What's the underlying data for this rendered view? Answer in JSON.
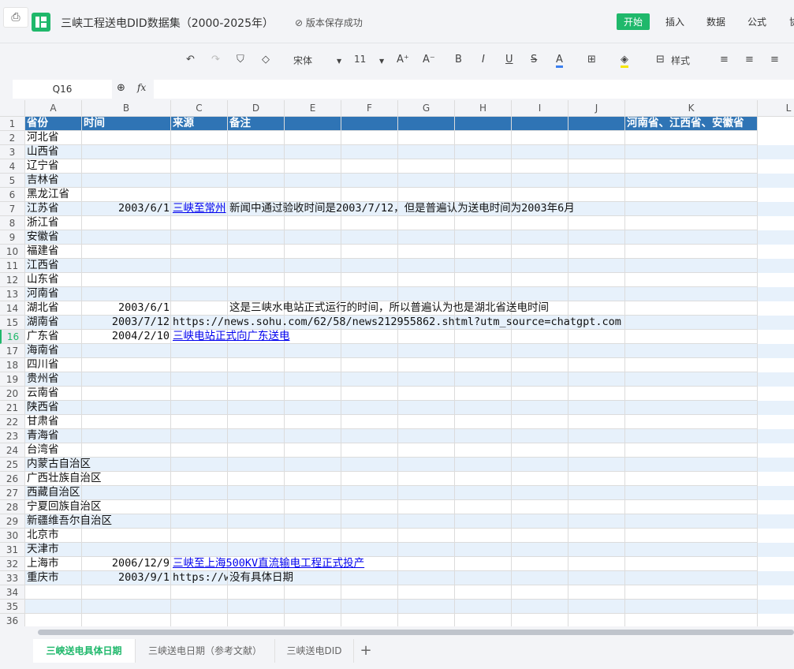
{
  "header": {
    "title": "三峡工程送电DID数据集（2000-2025年）",
    "save_status": "版本保存成功",
    "menus": [
      {
        "label": "开始",
        "active": true
      },
      {
        "label": "插入"
      },
      {
        "label": "数据"
      },
      {
        "label": "公式"
      },
      {
        "label": "协"
      }
    ]
  },
  "toolbar": {
    "font": "宋体",
    "size": "11",
    "style_label": "样式",
    "font_color": "#3b7ff0",
    "fill_color": "#f7e600"
  },
  "formula_bar": {
    "name_box": "Q16",
    "fx": "fx",
    "value": ""
  },
  "grid": {
    "columns": [
      "A",
      "B",
      "C",
      "D",
      "E",
      "F",
      "G",
      "H",
      "I",
      "J",
      "K",
      "L"
    ],
    "header_fill": "#2f74b5",
    "stripe_fill": "#e7f1fb",
    "selected_row": 16,
    "rows": [
      [
        "省份",
        "时间",
        "来源",
        "备注",
        "",
        "",
        "",
        "",
        "",
        "",
        "河南省、江西省、安徽省"
      ],
      [
        "河北省"
      ],
      [
        "山西省"
      ],
      [
        "辽宁省"
      ],
      [
        "吉林省"
      ],
      [
        "黑龙江省"
      ],
      [
        "江苏省",
        "2003/6/1",
        "三峡至常州",
        "新闻中通过验收时间是2003/7/12，但是普遍认为送电时间为2003年6月"
      ],
      [
        "浙江省"
      ],
      [
        "安徽省"
      ],
      [
        "福建省"
      ],
      [
        "江西省"
      ],
      [
        "山东省"
      ],
      [
        "河南省"
      ],
      [
        "湖北省",
        "2003/6/1",
        "",
        "这是三峡水电站正式运行的时间，所以普遍认为也是湖北省送电时间"
      ],
      [
        "湖南省",
        "2003/7/12",
        "https://news.sohu.com/62/58/news212955862.shtml?utm_source=chatgpt.com"
      ],
      [
        "广东省",
        "2004/2/10",
        "三峡电站正式向广东送电"
      ],
      [
        "海南省"
      ],
      [
        "四川省"
      ],
      [
        "贵州省"
      ],
      [
        "云南省"
      ],
      [
        "陕西省"
      ],
      [
        "甘肃省"
      ],
      [
        "青海省"
      ],
      [
        "台湾省"
      ],
      [
        "内蒙古自治区"
      ],
      [
        "广西壮族自治区"
      ],
      [
        "西藏自治区"
      ],
      [
        "宁夏回族自治区"
      ],
      [
        "新疆维吾尔自治区"
      ],
      [
        "北京市"
      ],
      [
        "天津市"
      ],
      [
        "上海市",
        "2006/12/9",
        "三峡至上海500KV直流输电工程正式投产"
      ],
      [
        "重庆市",
        "2003/9/1",
        "https://www.",
        "没有具体日期"
      ],
      [],
      [],
      []
    ],
    "links": [
      "6-2",
      "15-2",
      "31-2"
    ]
  },
  "sheets": [
    {
      "label": "三峡送电具体日期",
      "active": true
    },
    {
      "label": "三峡送电日期（参考文献）"
    },
    {
      "label": "三峡送电DID"
    }
  ],
  "add_sheet": "+"
}
